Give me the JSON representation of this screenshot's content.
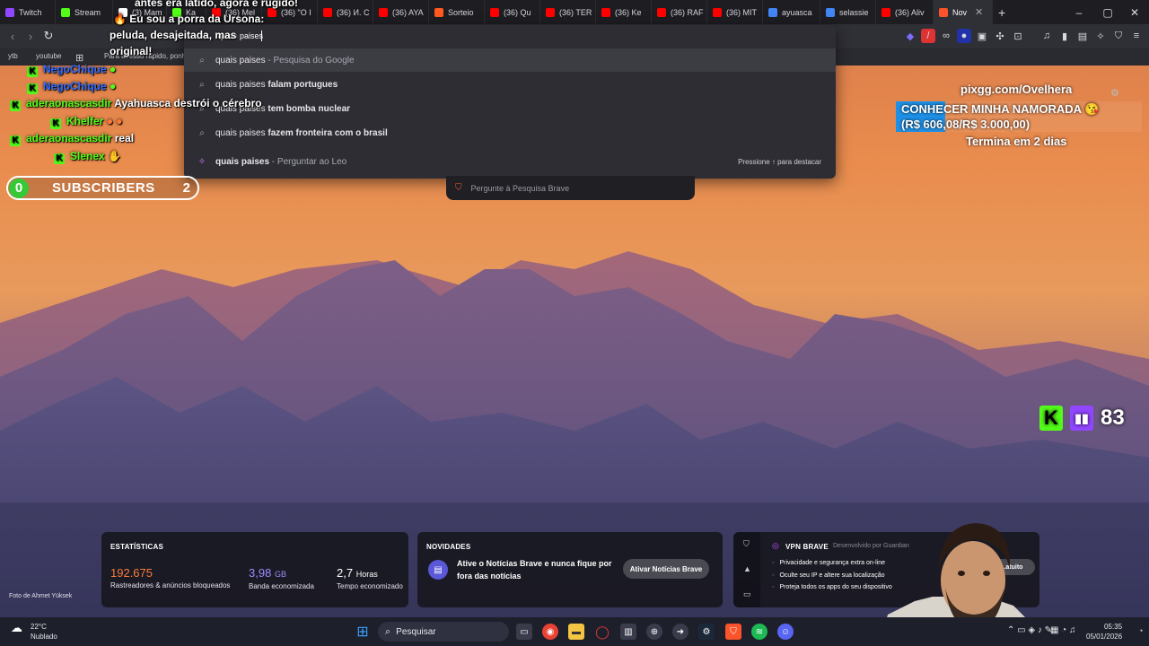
{
  "tabs": [
    {
      "label": "Twitch",
      "color": "#9146ff"
    },
    {
      "label": "Stream",
      "color": "#53fc18"
    },
    {
      "label": "(3) Mam",
      "color": "#ffffff"
    },
    {
      "label": "Ka",
      "color": "#53fc18"
    },
    {
      "label": "(36) Mel",
      "color": "#ff0000"
    },
    {
      "label": "(36) \"O I",
      "color": "#ff0000"
    },
    {
      "label": "(36) И. С",
      "color": "#ff0000"
    },
    {
      "label": "(36) AYA",
      "color": "#ff0000"
    },
    {
      "label": "Sorteio",
      "color": "#ff5a1f"
    },
    {
      "label": "(36) Qu",
      "color": "#ff0000"
    },
    {
      "label": "(36) TER",
      "color": "#ff0000"
    },
    {
      "label": "(36) Ke",
      "color": "#ff0000"
    },
    {
      "label": "(36) RAF",
      "color": "#ff0000"
    },
    {
      "label": "(36) MIT",
      "color": "#ff0000"
    },
    {
      "label": "ayuasca",
      "color": "#4285f4"
    },
    {
      "label": "selassie",
      "color": "#4285f4"
    },
    {
      "label": "(36) Aliv",
      "color": "#ff0000"
    },
    {
      "label": "Nov",
      "color": "#fb542b",
      "active": true
    }
  ],
  "omnibox": {
    "query": "quais paises",
    "rows": [
      {
        "prefix": "quais paises",
        "bold": "",
        "suffix": " - Pesquisa do Google"
      },
      {
        "prefix": "quais paises",
        "bold": " falam portugues",
        "suffix": ""
      },
      {
        "prefix": "quais paises",
        "bold": " tem bomba nuclear",
        "suffix": ""
      },
      {
        "prefix": "quais paises",
        "bold": " fazem fronteira com o brasil",
        "suffix": ""
      }
    ],
    "leo": {
      "bold": "quais paises",
      "suffix": " - Perguntar ao Leo"
    },
    "hint": "Pressione ↑ para destacar",
    "brave_ask": "Pergunte à Pesquisa Brave"
  },
  "bookmarks": {
    "ytb": "ytb",
    "youtube": "youtube",
    "quick_access": "Para acesso rápido, ponh"
  },
  "overlay": {
    "alert_top": "antes era latido, agora é rugido!",
    "alert_line2": "Eu sou a porra da Ursona:",
    "alert_line3": "peluda, desajeitada, mas",
    "alert_line4": "original!",
    "chat": [
      {
        "user": "NegoChique",
        "msg": "",
        "color": "blue"
      },
      {
        "user": "NegoChique",
        "msg": "",
        "color": "blue"
      },
      {
        "user": "aderaonascasdir",
        "msg": "Ayahuasca destrói o cérebro",
        "color": "green"
      },
      {
        "user": "Khelfer",
        "msg": "",
        "color": "green"
      },
      {
        "user": "aderaonascasdir",
        "msg": "real",
        "color": "green"
      },
      {
        "user": "Slenex",
        "msg": "",
        "color": "green"
      }
    ],
    "subs_left": "0",
    "subs_label": "SUBSCRIBERS",
    "subs_right": "2",
    "pixgg": "pixgg.com/Ovelhera",
    "goal_title": "CONHECER MINHA NAMORADA",
    "goal_amount": "(R$ 606,08/R$ 3.000,00)",
    "goal_progress": 0.2,
    "goal_ends": "Termina em 2 dias",
    "viewers": "83"
  },
  "stats": {
    "header": "ESTATÍSTICAS",
    "trackers_value": "192.675",
    "trackers_label": "Rastreadores & anúncios bloqueados",
    "bandwidth_value": "3,98",
    "bandwidth_unit": "GB",
    "bandwidth_label": "Banda economizada",
    "time_value": "2,7",
    "time_unit": "Horas",
    "time_label": "Tempo economizado"
  },
  "news": {
    "header": "NOVIDADES",
    "text": "Ative o Notícias Brave e nunca fique por fora das notícias",
    "button": "Ativar Notícias Brave"
  },
  "vpn": {
    "title": "VPN BRAVE",
    "powered": "Desenvolvido por Guardian",
    "items": [
      "Privacidade e segurança extra on-line",
      "Oculte seu IP e altere sua localização",
      "Proteja todos os apps do seu dispositivo"
    ],
    "button": "...atuito"
  },
  "photo_credit": "Foto de Ahmet Yüksek",
  "weather": {
    "temp": "22°C",
    "desc": "Nublado"
  },
  "taskbar": {
    "search": "Pesquisar",
    "time": "05:35",
    "date": "05/01/2026"
  },
  "colors": {
    "accent_orange": "#fb542b",
    "kick_green": "#53fc18",
    "twitch_purple": "#9146ff",
    "goal_blue": "#1e90e6"
  }
}
